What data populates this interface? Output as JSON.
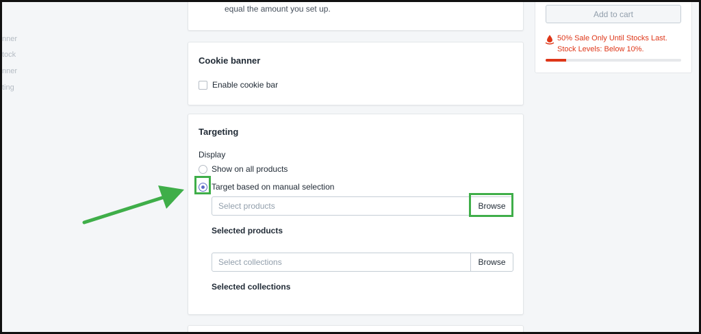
{
  "left_nav": {
    "items": [
      "nner",
      "tock",
      "nner",
      "ting"
    ]
  },
  "top_card": {
    "description": "equal the amount you set up."
  },
  "cookie_card": {
    "title": "Cookie banner",
    "enable_label": "Enable cookie bar",
    "enabled": false
  },
  "targeting_card": {
    "title": "Targeting",
    "display_label": "Display",
    "options": [
      {
        "label": "Show on all products",
        "selected": false
      },
      {
        "label": "Target based on manual selection",
        "selected": true
      }
    ],
    "products_placeholder": "Select products",
    "products_browse": "Browse",
    "selected_products_heading": "Selected products",
    "collections_placeholder": "Select collections",
    "collections_browse": "Browse",
    "selected_collections_heading": "Selected collections"
  },
  "preview": {
    "add_to_cart": "Add to cart",
    "sale_line1": "50% Sale Only Until Stocks Last.",
    "sale_line2": "Stock Levels: Below 10%.",
    "stock_level_percent": 15,
    "accent_color": "#de3618"
  },
  "annotation": {
    "highlight_color": "#3fae49",
    "arrow_icon": "arrow-icon"
  }
}
